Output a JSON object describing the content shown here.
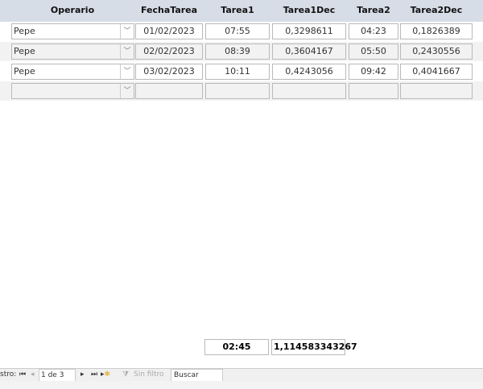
{
  "columns": [
    "Operario",
    "FechaTarea",
    "Tarea1",
    "Tarea1Dec",
    "Tarea2",
    "Tarea2Dec"
  ],
  "rows": [
    {
      "operario": "Pepe",
      "fecha": "01/02/2023",
      "tarea1": "07:55",
      "tarea1dec": "0,3298611",
      "tarea2": "04:23",
      "tarea2dec": "0,1826389"
    },
    {
      "operario": "Pepe",
      "fecha": "02/02/2023",
      "tarea1": "08:39",
      "tarea1dec": "0,3604167",
      "tarea2": "05:50",
      "tarea2dec": "0,2430556"
    },
    {
      "operario": "Pepe",
      "fecha": "03/02/2023",
      "tarea1": "10:11",
      "tarea1dec": "0,4243056",
      "tarea2": "09:42",
      "tarea2dec": "0,4041667"
    }
  ],
  "totals": {
    "tarea1": "02:45",
    "tarea1dec": "1,114583343267"
  },
  "nav": {
    "label": "stro:",
    "record": "1 de 3",
    "filter": "Sin filtro",
    "search": "Buscar"
  }
}
